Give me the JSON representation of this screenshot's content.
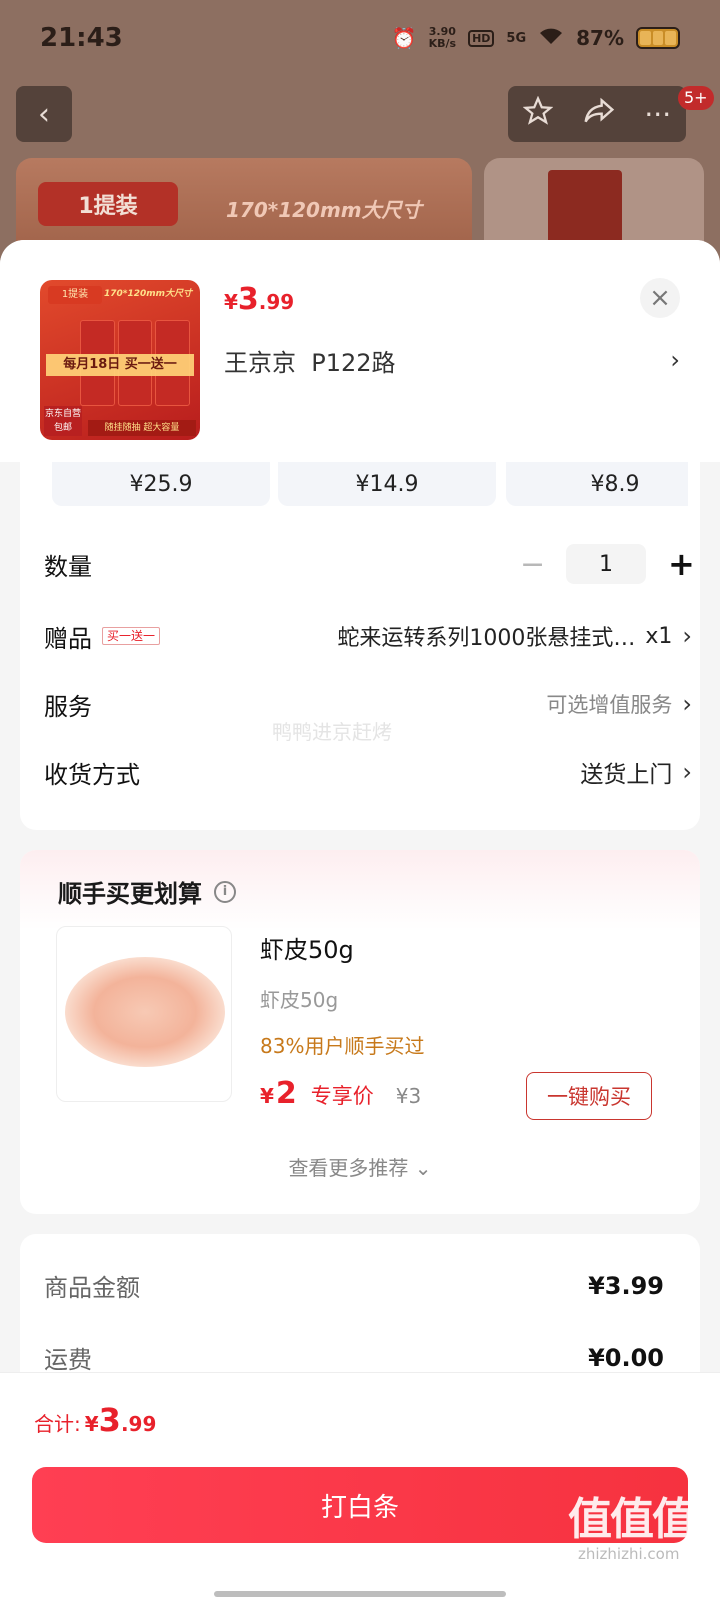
{
  "status_bar": {
    "time": "21:43",
    "net_speed_top": "3.90",
    "net_speed_bottom": "KB/s",
    "hd": "HD",
    "signal": "5G",
    "battery": "87%"
  },
  "background": {
    "cart_badge": "5+",
    "banner_tag": "1提装",
    "banner_slogan": "170*120mm大尺寸"
  },
  "product": {
    "thumb": {
      "band": "1提装",
      "title": "170*120mm大尺寸",
      "promo": "每月18日 买一送一",
      "self_operated": "京东自营 包邮",
      "feature": "随挂随抽 超大容量"
    },
    "price_currency": "¥",
    "price_int": "3",
    "price_dec": ".99",
    "address": "王京京  P122路"
  },
  "variants": [
    {
      "price": "¥25.9"
    },
    {
      "price": "¥14.9"
    },
    {
      "price": "¥8.9"
    }
  ],
  "options": {
    "quantity_label": "数量",
    "quantity_value": "1",
    "gift_label": "赠品",
    "gift_tag": "买一送一",
    "gift_text": "蛇来运转系列1000张悬挂式…",
    "gift_count": "x1",
    "service_label": "服务",
    "service_value": "可选增值服务",
    "delivery_label": "收货方式",
    "delivery_value": "送货上门",
    "watermark": "鸭鸭进京赶烤"
  },
  "recommendation": {
    "title": "顺手买更划算",
    "item_name": "虾皮50g",
    "item_sub": "虾皮50g",
    "item_stat": "83%用户顺手买过",
    "price_currency": "¥",
    "price_int": "2",
    "price_label": "专享价",
    "original_price": "¥3",
    "buy_label": "一键购买",
    "more_label": "查看更多推荐"
  },
  "summary": {
    "goods_label": "商品金额",
    "goods_value": "¥3.99",
    "shipping_label": "运费",
    "shipping_value": "¥0.00"
  },
  "footer": {
    "total_label": "合计:",
    "total_currency": "¥",
    "total_int": "3",
    "total_dec": ".99",
    "pay_label": "打白条",
    "site_mark": "值值值",
    "site_url": "zhizhizhi.com"
  },
  "colors": {
    "accent_red": "#e8212b",
    "pay_button": "#f6323f",
    "stat_orange": "#c7791b"
  },
  "icons": [
    "back-arrow-icon",
    "star-icon",
    "share-icon",
    "more-icon",
    "close-icon",
    "chevron-right-icon",
    "minus-icon",
    "plus-icon",
    "info-icon",
    "chevron-down-icon"
  ]
}
